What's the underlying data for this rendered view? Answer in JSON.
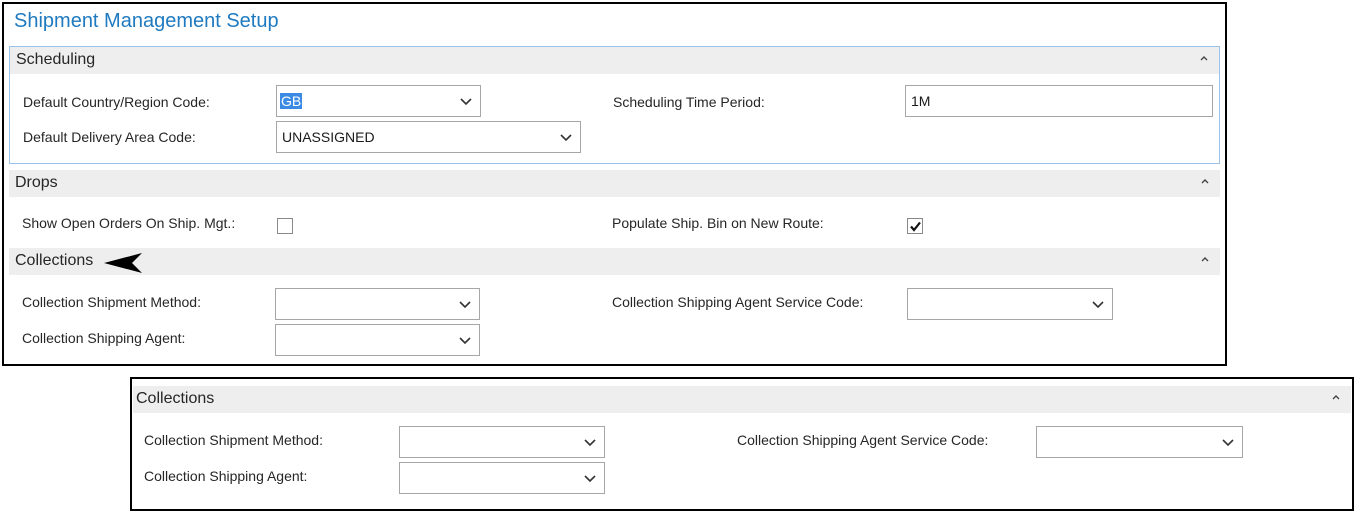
{
  "page_title": "Shipment Management Setup",
  "scheduling": {
    "title": "Scheduling",
    "default_country_label": "Default Country/Region Code:",
    "default_country_value": "GB",
    "default_delivery_label": "Default Delivery Area Code:",
    "default_delivery_value": "UNASSIGNED",
    "time_period_label": "Scheduling Time Period:",
    "time_period_value": "1M"
  },
  "drops": {
    "title": "Drops",
    "show_open_orders_label": "Show Open Orders On Ship. Mgt.:",
    "show_open_orders_checked": false,
    "populate_bin_label": "Populate Ship. Bin on New Route:",
    "populate_bin_checked": true
  },
  "collections": {
    "title": "Collections",
    "shipment_method_label": "Collection Shipment Method:",
    "shipment_method_value": "",
    "shipping_agent_label": "Collection Shipping Agent:",
    "shipping_agent_value": "",
    "agent_service_label": "Collection Shipping Agent Service Code:",
    "agent_service_value": ""
  },
  "colors": {
    "title_blue": "#1f7ac0",
    "header_gray": "#eeeeee",
    "selection_blue": "#3c8ae3",
    "focus_border": "#9cc3ec"
  },
  "icons": [
    "chevron-up-icon",
    "chevron-down-icon",
    "checkmark-icon",
    "arrow-pointer-icon"
  ]
}
